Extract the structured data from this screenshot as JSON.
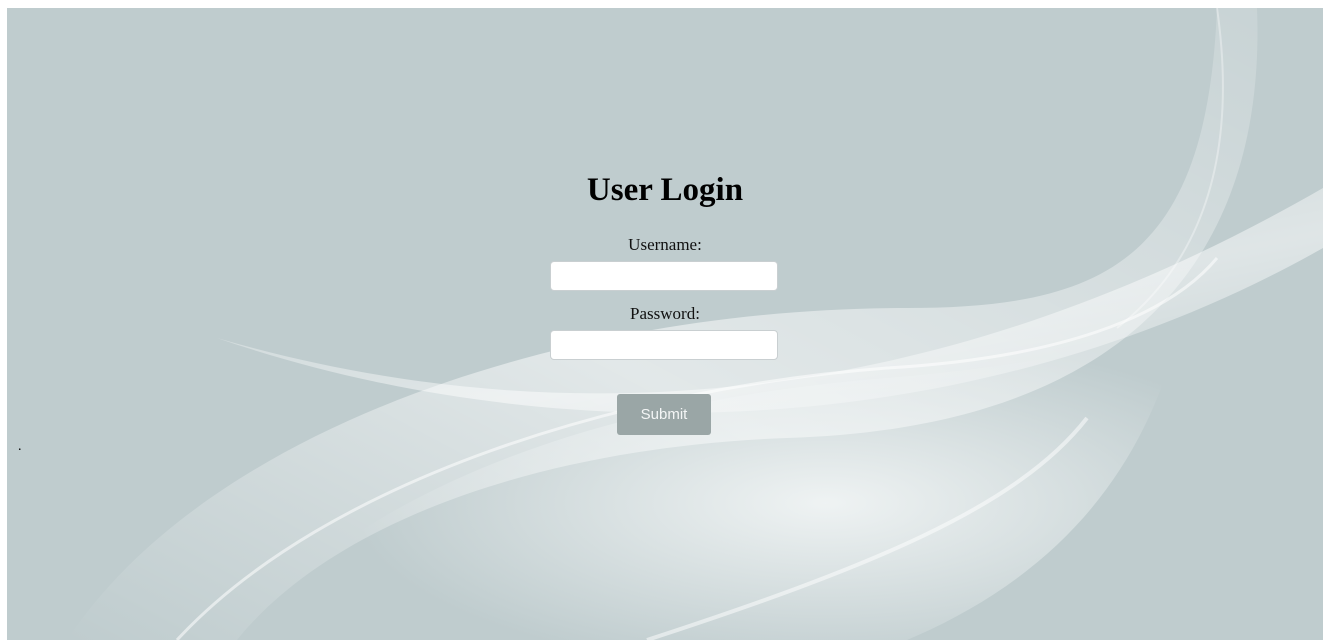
{
  "page": {
    "background_color": "#c0cdcf"
  },
  "login": {
    "title": "User Login",
    "username_label": "Username:",
    "username_value": "",
    "password_label": "Password:",
    "password_value": "",
    "submit_label": "Submit",
    "submit_color": "#9aa6a6"
  },
  "stray_text": "."
}
